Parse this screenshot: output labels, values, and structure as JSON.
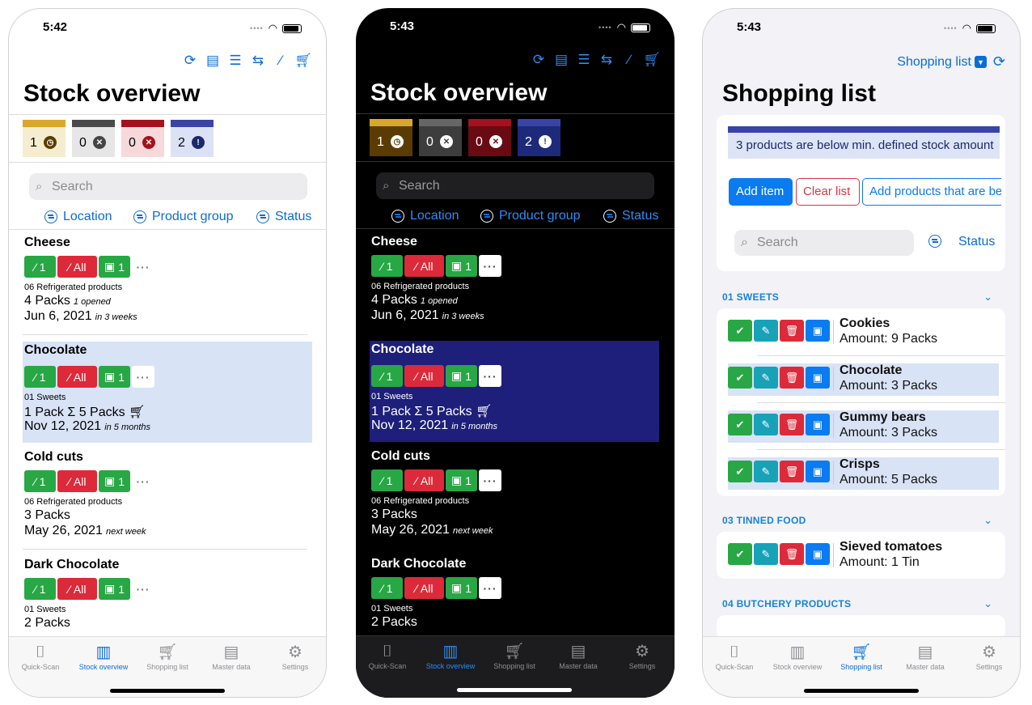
{
  "status_bars": [
    {
      "time": "5:42"
    },
    {
      "time": "5:43"
    },
    {
      "time": "5:43"
    }
  ],
  "stock": {
    "title": "Stock overview",
    "chips": [
      {
        "count": "1",
        "bar": "#d9a62e",
        "bg": "#f6ecd0",
        "icon": "clock-icon",
        "glyph": "◷",
        "icbg": "#5b3c00"
      },
      {
        "count": "0",
        "bar": "#4a4a4a",
        "bg": "#e6e6e6",
        "icon": "x-circle-icon",
        "glyph": "✕",
        "icbg": "#444"
      },
      {
        "count": "0",
        "bar": "#a3121e",
        "bg": "#f7d9db",
        "icon": "x-circle-red-icon",
        "glyph": "✕",
        "icbg": "#a3121e"
      },
      {
        "count": "2",
        "bar": "#3a44a6",
        "bg": "#dce2f6",
        "icon": "exclamation-icon",
        "glyph": "!",
        "icbg": "#1b2a6b"
      }
    ],
    "search_placeholder": "Search",
    "filters": [
      "Location",
      "Product group",
      "Status"
    ],
    "buttons": {
      "consume_one": "1",
      "consume_all": "All",
      "open_one": "1"
    },
    "items": [
      {
        "name": "Cheese",
        "group": "06 Refrigerated products",
        "amount": "4 Packs",
        "amount_note": "1 opened",
        "date": "Jun 6, 2021",
        "due": "in 3 weeks"
      },
      {
        "name": "Chocolate",
        "group": "01 Sweets",
        "amount": "1 Pack  Σ 5 Packs",
        "amount_note": "",
        "date": "Nov 12, 2021",
        "due": "in 5 months"
      },
      {
        "name": "Cold cuts",
        "group": "06 Refrigerated products",
        "amount": "3 Packs",
        "amount_note": "",
        "date": "May 26, 2021",
        "due": "next week"
      },
      {
        "name": "Dark Chocolate",
        "group": "01 Sweets",
        "amount": "2 Packs",
        "amount_note": "",
        "date": "",
        "due": ""
      }
    ]
  },
  "tabs": [
    "Quick-Scan",
    "Stock overview",
    "Shopping list",
    "Master data",
    "Settings"
  ],
  "shopping": {
    "header_link": "Shopping list",
    "title": "Shopping list",
    "alert": "3 products are below min. defined stock amount",
    "add_item": "Add item",
    "clear_list": "Clear list",
    "add_below": "Add products that are below min. stock",
    "search_placeholder": "Search",
    "status_filter": "Status",
    "sections": [
      {
        "name": "01 SWEETS",
        "items": [
          {
            "name": "Cookies",
            "amount": "Amount: 9 Packs"
          },
          {
            "name": "Chocolate",
            "amount": "Amount: 3 Packs"
          },
          {
            "name": "Gummy bears",
            "amount": "Amount: 3 Packs"
          },
          {
            "name": "Crisps",
            "amount": "Amount: 5 Packs"
          }
        ]
      },
      {
        "name": "03 TINNED FOOD",
        "items": [
          {
            "name": "Sieved tomatoes",
            "amount": "Amount: 1 Tin"
          }
        ]
      },
      {
        "name": "04 BUTCHERY PRODUCTS",
        "items": []
      }
    ]
  },
  "colors": {
    "accent": "#0a6cd6",
    "green": "#28a745",
    "red": "#dc2a3a",
    "highlight_light": "#d9e3f6",
    "highlight_dark": "#1d1f7a"
  }
}
